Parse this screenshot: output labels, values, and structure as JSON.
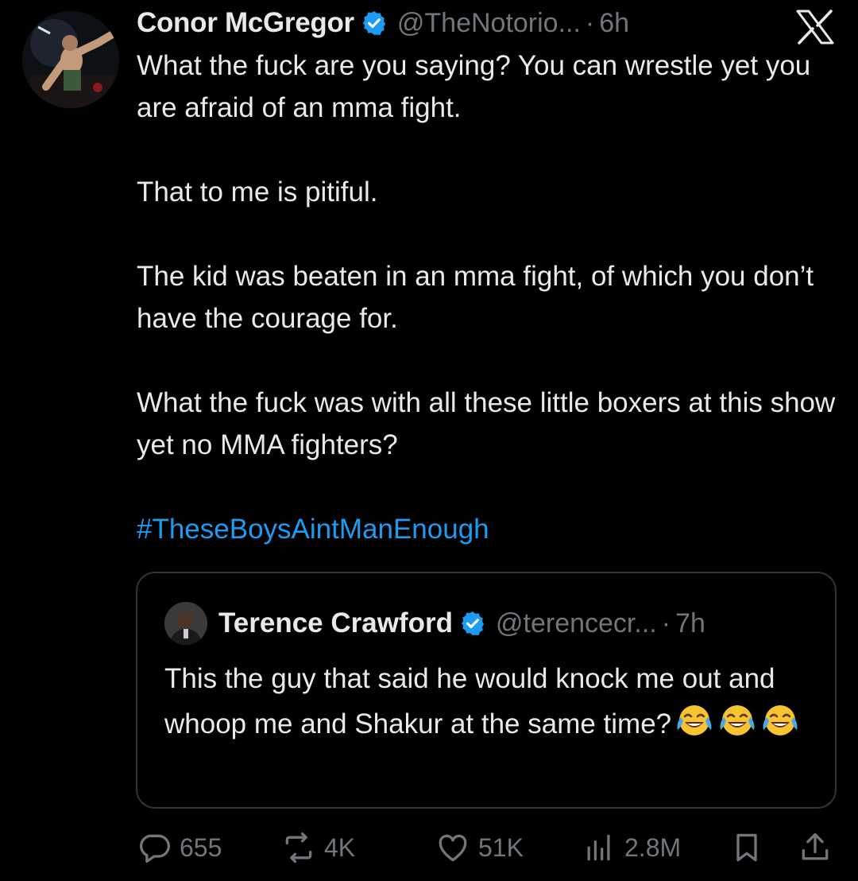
{
  "tweet": {
    "author_name": "Conor McGregor",
    "handle": "@TheNotorio...",
    "separator": "·",
    "time": "6h",
    "paragraphs": [
      "What the fuck are you saying? You can wrestle yet you are afraid of an mma fight.",
      "That to me is pitiful.",
      "The kid was beaten in an mma fight, of which you don’t have the courage for.",
      "What the fuck was with all these little boxers at this show yet no MMA fighters?"
    ],
    "hashtag": "#TheseBoysAintManEnough"
  },
  "quoted": {
    "author_name": "Terence Crawford",
    "handle": "@terencecr...",
    "separator": "·",
    "time": "7h",
    "text": "This the guy that said he would knock me out and whoop me and Shakur at the same time?",
    "emoji_count": 3
  },
  "actions": {
    "replies": "655",
    "reposts": "4K",
    "likes": "51K",
    "views": "2.8M"
  },
  "colors": {
    "background": "#000000",
    "text": "#e7e9ea",
    "muted": "#71767b",
    "accent": "#1d9bf0",
    "border": "#2f3336"
  },
  "icons": [
    "verified-badge-icon",
    "x-logo-icon",
    "reply-icon",
    "repost-icon",
    "like-icon",
    "views-icon",
    "bookmark-icon",
    "share-icon",
    "joy-emoji-icon"
  ]
}
